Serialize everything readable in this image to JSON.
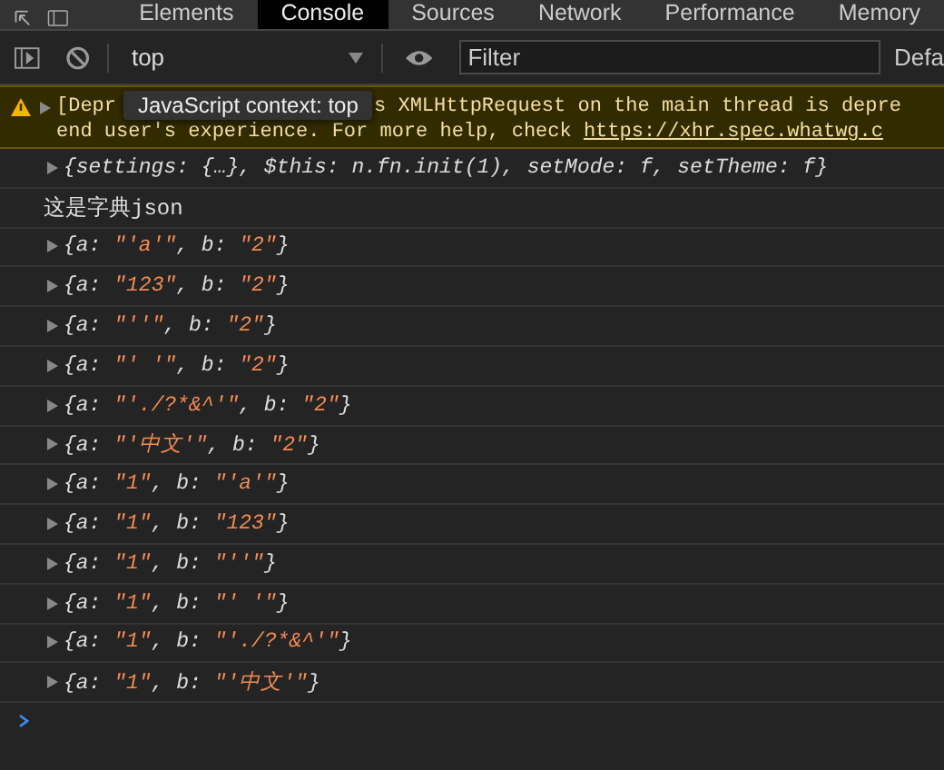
{
  "tabs": [
    {
      "label": "Elements",
      "selected": false
    },
    {
      "label": "Console",
      "selected": true
    },
    {
      "label": "Sources",
      "selected": false
    },
    {
      "label": "Network",
      "selected": false
    },
    {
      "label": "Performance",
      "selected": false
    },
    {
      "label": "Memory",
      "selected": false
    }
  ],
  "toolbar": {
    "context": "top",
    "filter": {
      "placeholder": "Filter"
    },
    "levels": "Defa"
  },
  "tooltip": "JavaScript context: top",
  "warning": {
    "line1_start": "[Depr",
    "line1_end": "s XMLHttpRequest on the main thread is depre",
    "line2": "end user's experience. For more help, check ",
    "link": "https://xhr.spec.whatwg.c"
  },
  "entries": [
    {
      "kind": "object",
      "parts": [
        {
          "kind": "plain",
          "text": "{settings: {…}, $this: n.fn.init(1), setMode: f, setTheme: f}"
        }
      ]
    },
    {
      "kind": "text",
      "text": "这是字典json"
    },
    {
      "kind": "object",
      "parts": [
        {
          "kind": "plain",
          "text": "{a: "
        },
        {
          "kind": "string",
          "text": "\"'a'\""
        },
        {
          "kind": "plain",
          "text": ", b: "
        },
        {
          "kind": "string",
          "text": "\"2\""
        },
        {
          "kind": "plain",
          "text": "}"
        }
      ]
    },
    {
      "kind": "object",
      "parts": [
        {
          "kind": "plain",
          "text": "{a: "
        },
        {
          "kind": "string",
          "text": "\"123\""
        },
        {
          "kind": "plain",
          "text": ", b: "
        },
        {
          "kind": "string",
          "text": "\"2\""
        },
        {
          "kind": "plain",
          "text": "}"
        }
      ]
    },
    {
      "kind": "object",
      "parts": [
        {
          "kind": "plain",
          "text": "{a: "
        },
        {
          "kind": "string",
          "text": "\"''\""
        },
        {
          "kind": "plain",
          "text": ", b: "
        },
        {
          "kind": "string",
          "text": "\"2\""
        },
        {
          "kind": "plain",
          "text": "}"
        }
      ]
    },
    {
      "kind": "object",
      "parts": [
        {
          "kind": "plain",
          "text": "{a: "
        },
        {
          "kind": "string",
          "text": "\"' '\""
        },
        {
          "kind": "plain",
          "text": ", b: "
        },
        {
          "kind": "string",
          "text": "\"2\""
        },
        {
          "kind": "plain",
          "text": "}"
        }
      ]
    },
    {
      "kind": "object",
      "parts": [
        {
          "kind": "plain",
          "text": "{a: "
        },
        {
          "kind": "string",
          "text": "\"'./?*&^'\""
        },
        {
          "kind": "plain",
          "text": ", b: "
        },
        {
          "kind": "string",
          "text": "\"2\""
        },
        {
          "kind": "plain",
          "text": "}"
        }
      ]
    },
    {
      "kind": "object",
      "parts": [
        {
          "kind": "plain",
          "text": "{a: "
        },
        {
          "kind": "string",
          "text": "\"'中文'\""
        },
        {
          "kind": "plain",
          "text": ", b: "
        },
        {
          "kind": "string",
          "text": "\"2\""
        },
        {
          "kind": "plain",
          "text": "}"
        }
      ]
    },
    {
      "kind": "object",
      "parts": [
        {
          "kind": "plain",
          "text": "{a: "
        },
        {
          "kind": "string",
          "text": "\"1\""
        },
        {
          "kind": "plain",
          "text": ", b: "
        },
        {
          "kind": "string",
          "text": "\"'a'\""
        },
        {
          "kind": "plain",
          "text": "}"
        }
      ]
    },
    {
      "kind": "object",
      "parts": [
        {
          "kind": "plain",
          "text": "{a: "
        },
        {
          "kind": "string",
          "text": "\"1\""
        },
        {
          "kind": "plain",
          "text": ", b: "
        },
        {
          "kind": "string",
          "text": "\"123\""
        },
        {
          "kind": "plain",
          "text": "}"
        }
      ]
    },
    {
      "kind": "object",
      "parts": [
        {
          "kind": "plain",
          "text": "{a: "
        },
        {
          "kind": "string",
          "text": "\"1\""
        },
        {
          "kind": "plain",
          "text": ", b: "
        },
        {
          "kind": "string",
          "text": "\"''\""
        },
        {
          "kind": "plain",
          "text": "}"
        }
      ]
    },
    {
      "kind": "object",
      "parts": [
        {
          "kind": "plain",
          "text": "{a: "
        },
        {
          "kind": "string",
          "text": "\"1\""
        },
        {
          "kind": "plain",
          "text": ", b: "
        },
        {
          "kind": "string",
          "text": "\"' '\""
        },
        {
          "kind": "plain",
          "text": "}"
        }
      ]
    },
    {
      "kind": "object",
      "parts": [
        {
          "kind": "plain",
          "text": "{a: "
        },
        {
          "kind": "string",
          "text": "\"1\""
        },
        {
          "kind": "plain",
          "text": ", b: "
        },
        {
          "kind": "string",
          "text": "\"'./?*&^'\""
        },
        {
          "kind": "plain",
          "text": "}"
        }
      ]
    },
    {
      "kind": "object",
      "parts": [
        {
          "kind": "plain",
          "text": "{a: "
        },
        {
          "kind": "string",
          "text": "\"1\""
        },
        {
          "kind": "plain",
          "text": ", b: "
        },
        {
          "kind": "string",
          "text": "\"'中文'\""
        },
        {
          "kind": "plain",
          "text": "}"
        }
      ]
    }
  ]
}
